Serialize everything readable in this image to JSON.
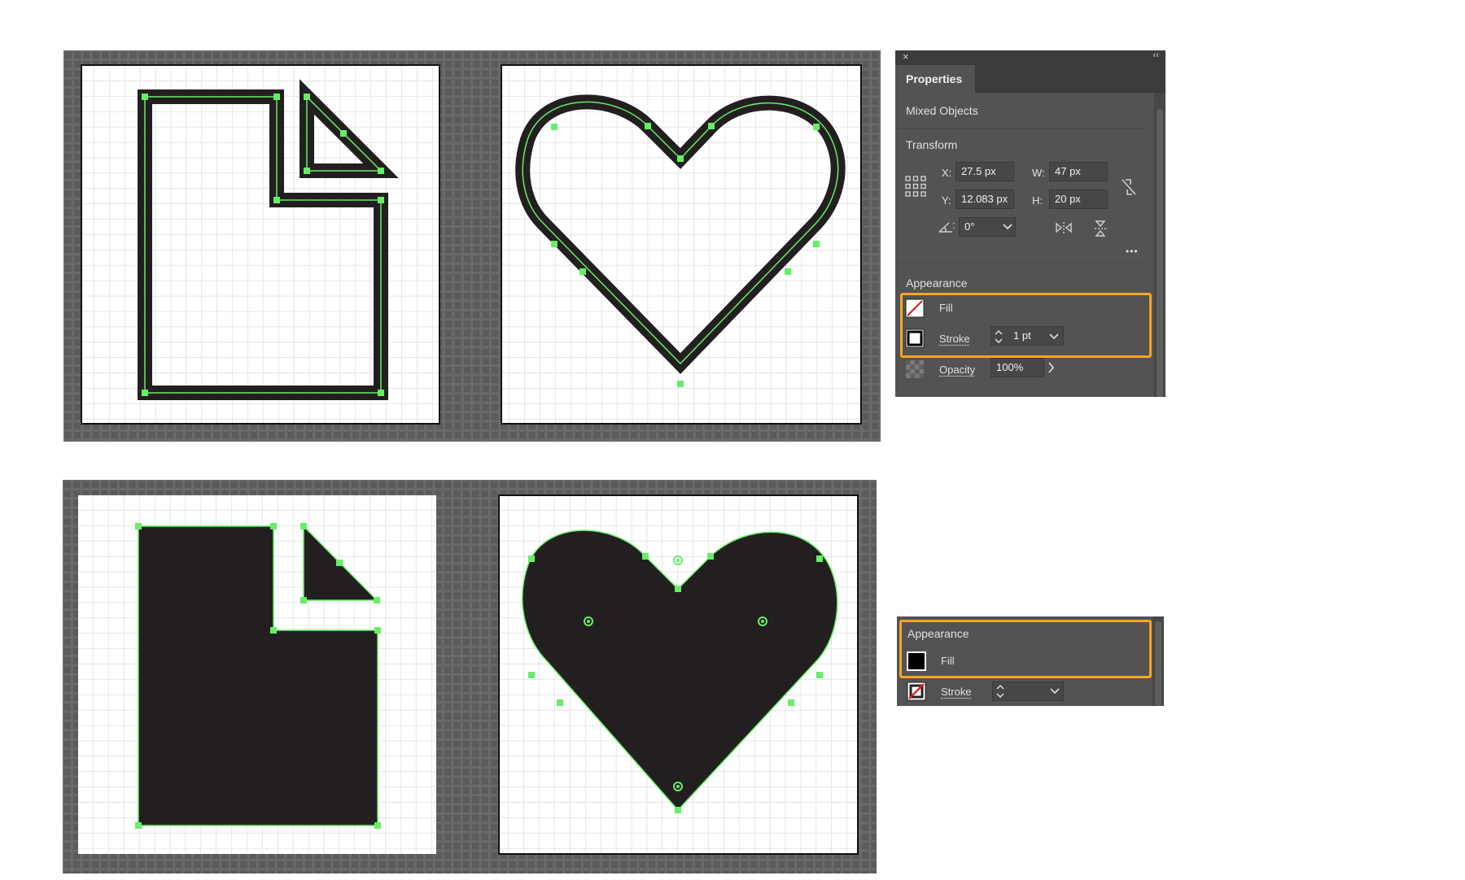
{
  "colors": {
    "canvas_frame": "#696969",
    "grid_line": "#d6d6e2",
    "selection": "#66ee66",
    "shape": "#231f20",
    "panel_bg": "#535353",
    "highlight": "#f5a623"
  },
  "panel_top": {
    "close_glyph": "×",
    "collapse_glyph": "‹‹",
    "tab_label": "Properties",
    "selection_label": "Mixed Objects",
    "transform": {
      "title": "Transform",
      "x_label": "X:",
      "x_value": "27.5 px",
      "y_label": "Y:",
      "y_value": "12.083 px",
      "w_label": "W:",
      "w_value": "47 px",
      "h_label": "H:",
      "h_value": "20 px",
      "angle_value": "0°",
      "more_glyph": "•••"
    },
    "appearance": {
      "title": "Appearance",
      "fill_label": "Fill",
      "stroke_label": "Stroke",
      "stroke_weight": "1 pt",
      "opacity_label": "Opacity",
      "opacity_value": "100%"
    }
  },
  "panel_bottom": {
    "appearance": {
      "title": "Appearance",
      "fill_label": "Fill",
      "stroke_label": "Stroke"
    }
  }
}
